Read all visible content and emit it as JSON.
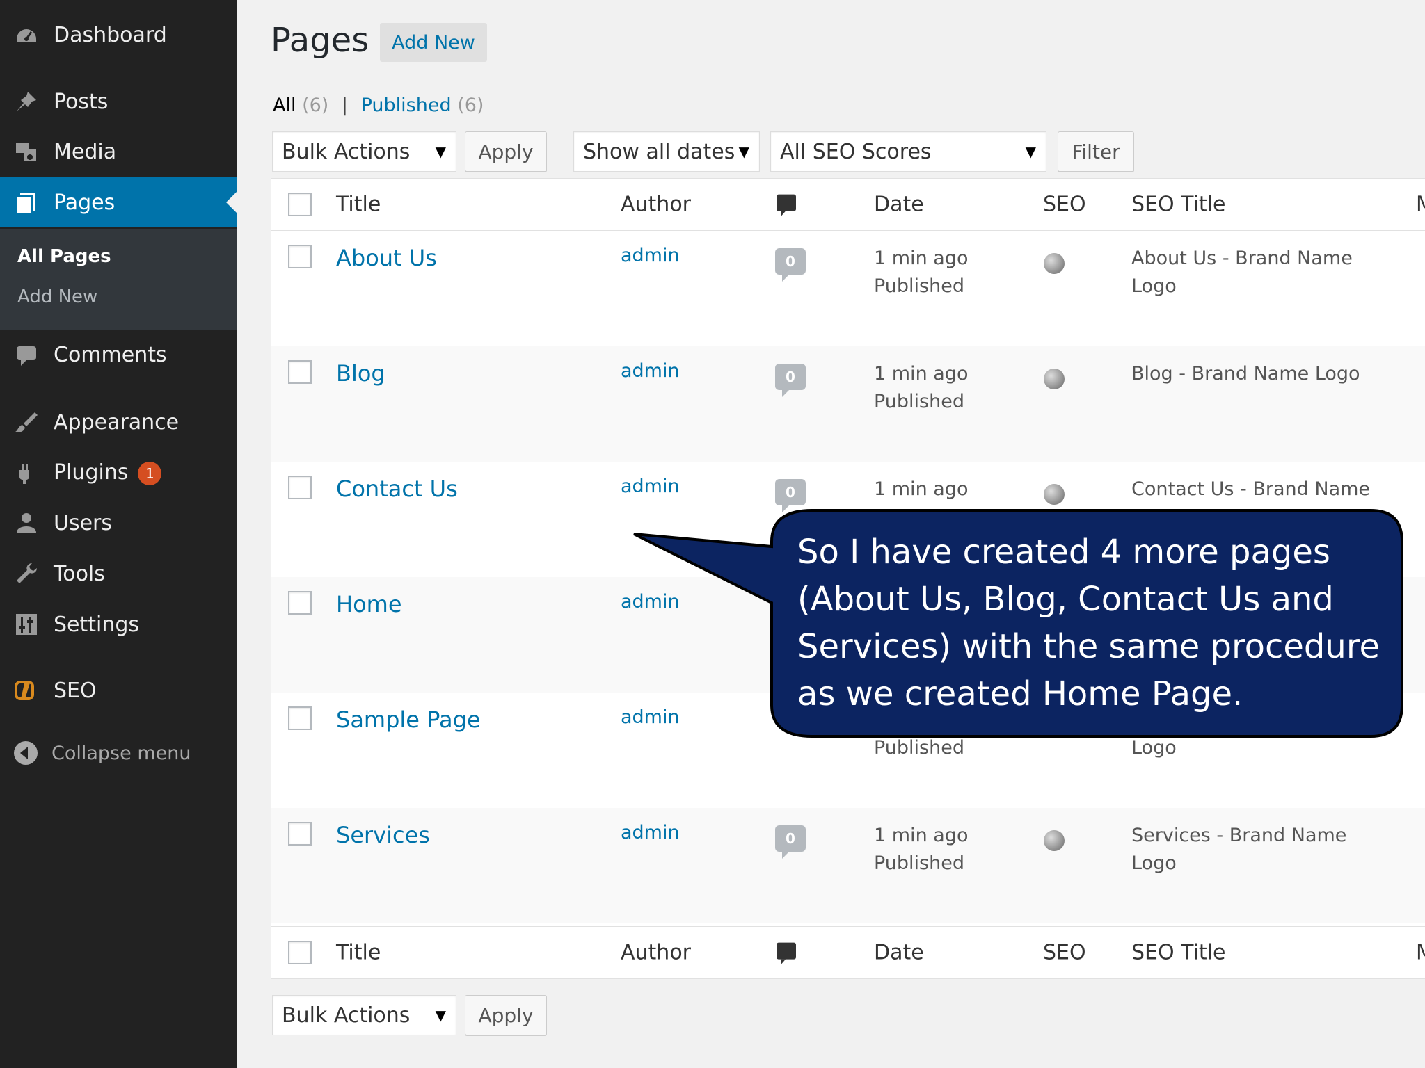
{
  "sidebar": {
    "items": [
      {
        "label": "Dashboard",
        "icon": "dashboard-icon"
      },
      {
        "label": "Posts",
        "icon": "pin-icon"
      },
      {
        "label": "Media",
        "icon": "media-icon"
      },
      {
        "label": "Pages",
        "icon": "pages-icon",
        "active": true
      },
      {
        "label": "Comments",
        "icon": "comments-icon"
      },
      {
        "label": "Appearance",
        "icon": "brush-icon"
      },
      {
        "label": "Plugins",
        "icon": "plugins-icon",
        "badge": "1"
      },
      {
        "label": "Users",
        "icon": "users-icon"
      },
      {
        "label": "Tools",
        "icon": "wrench-icon"
      },
      {
        "label": "Settings",
        "icon": "settings-icon"
      },
      {
        "label": "SEO",
        "icon": "seo-icon"
      }
    ],
    "submenu": [
      "All Pages",
      "Add New"
    ],
    "collapse": "Collapse menu",
    "active_color": "#0073aa"
  },
  "header": {
    "title": "Pages",
    "add_new": "Add New"
  },
  "filters": {
    "all_label": "All",
    "all_count": "(6)",
    "separator": "|",
    "published_label": "Published",
    "published_count": "(6)"
  },
  "toolbar": {
    "bulk_actions": "Bulk Actions",
    "apply": "Apply",
    "dates": "Show all dates",
    "seo_scores": "All SEO Scores",
    "filter": "Filter"
  },
  "table": {
    "columns": {
      "title": "Title",
      "author": "Author",
      "date": "Date",
      "seo": "SEO",
      "seo_title": "SEO Title",
      "extra": "M"
    },
    "rows": [
      {
        "title": "About Us",
        "author": "admin",
        "comments": "0",
        "date": "1 min ago",
        "status": "Published",
        "seo_title_1": "About Us - Brand Name",
        "seo_title_2": "Logo"
      },
      {
        "title": "Blog",
        "author": "admin",
        "comments": "0",
        "date": "1 min ago",
        "status": "Published",
        "seo_title_1": "Blog - Brand Name Logo",
        "seo_title_2": ""
      },
      {
        "title": "Contact Us",
        "author": "admin",
        "comments": "0",
        "date": "1 min ago",
        "status": "",
        "seo_title_1": "Contact Us - Brand Name",
        "seo_title_2": ""
      },
      {
        "title": "Home",
        "author": "admin",
        "comments": "",
        "date": "",
        "status": "",
        "seo_title_1": "",
        "seo_title_2": ""
      },
      {
        "title": "Sample Page",
        "author": "admin",
        "comments": "",
        "date": "",
        "status": "Published",
        "seo_title_1": "",
        "seo_title_2": "Logo"
      },
      {
        "title": "Services",
        "author": "admin",
        "comments": "0",
        "date": "1 min ago",
        "status": "Published",
        "seo_title_1": "Services - Brand Name Logo",
        "seo_title_2": ""
      }
    ]
  },
  "footer_toolbar": {
    "bulk_actions": "Bulk Actions",
    "apply": "Apply"
  },
  "callout": {
    "text": "So I have created 4 more pages (About Us, Blog, Contact Us and Services) with the same procedure as we created Home Page.",
    "fill": "#0c2461",
    "border": "#000000"
  }
}
